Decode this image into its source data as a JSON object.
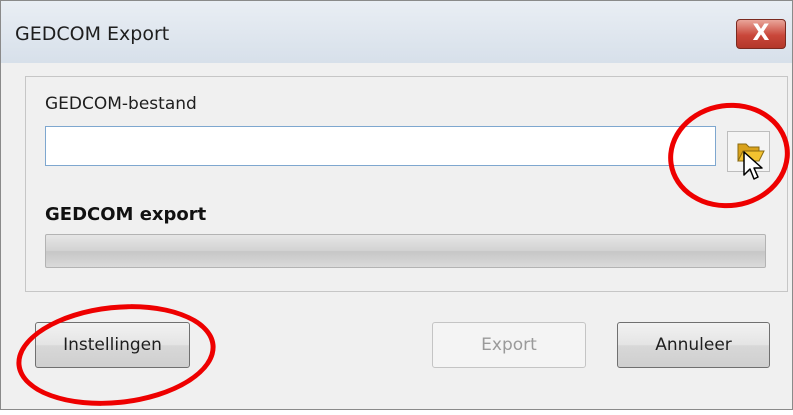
{
  "window": {
    "title": "GEDCOM Export",
    "close_symbol": "X"
  },
  "file": {
    "label": "GEDCOM-bestand",
    "value": "",
    "placeholder": ""
  },
  "export_section": {
    "label": "GEDCOM export",
    "progress": 0
  },
  "buttons": {
    "settings_label": "Instellingen",
    "export_label": "Export",
    "cancel_label": "Annuleer"
  },
  "icons": {
    "browse": "folder-open-icon",
    "close": "close-icon",
    "cursor": "mouse-pointer-icon"
  },
  "colors": {
    "annotation": "#ee0000",
    "close_button": "#c9473a",
    "folder": "#f2c230"
  }
}
